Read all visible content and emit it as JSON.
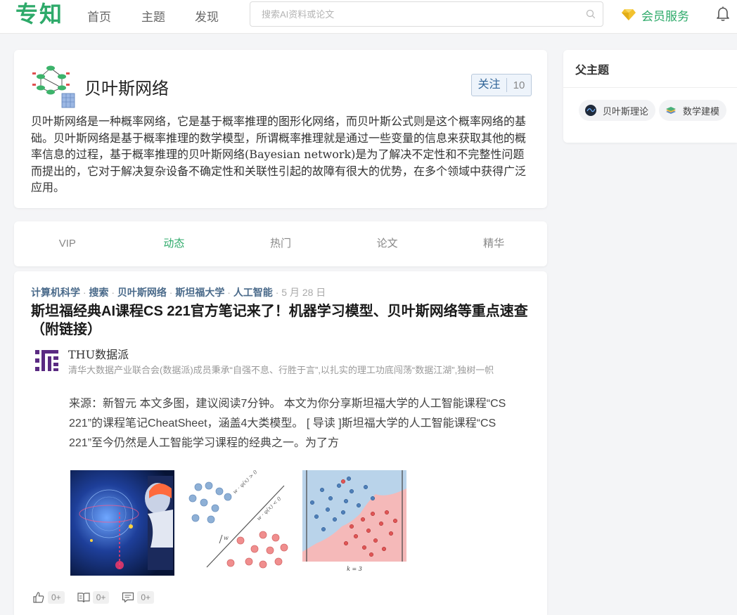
{
  "header": {
    "logo": "专知",
    "nav": [
      "首页",
      "主题",
      "发现"
    ],
    "search_placeholder": "搜索AI资料或论文",
    "vip_label": "会员服务"
  },
  "topic": {
    "title": "贝叶斯网络",
    "follow_label": "关注",
    "follow_count": "10",
    "description": "贝叶斯网络是一种概率网络，它是基于概率推理的图形化网络，而贝叶斯公式则是这个概率网络的基础。贝叶斯网络是基于概率推理的数学模型，所谓概率推理就是通过一些变量的信息来获取其他的概率信息的过程，基于概率推理的贝叶斯网络(Bayesian network)是为了解决不定性和不完整性问题而提出的，它对于解决复杂设备不确定性和关联性引起的故障有很大的优势，在多个领域中获得广泛应用。"
  },
  "tabs": [
    {
      "label": "VIP",
      "active": false
    },
    {
      "label": "动态",
      "active": true
    },
    {
      "label": "热门",
      "active": false
    },
    {
      "label": "论文",
      "active": false
    },
    {
      "label": "精华",
      "active": false
    }
  ],
  "article": {
    "tags": [
      "计算机科学",
      "搜索",
      "贝叶斯网络",
      "斯坦福大学",
      "人工智能"
    ],
    "separator": " · ",
    "date": "5 月 28 日",
    "title": "斯坦福经典AI课程CS 221官方笔记来了！机器学习模型、贝叶斯网络等重点速查（附链接）",
    "author_name": "THU数据派",
    "author_desc": "清华大数据产业联合会(数据派)成员秉承“自强不息、行胜于言”,以扎实的理工功底闯荡“数据江湖”,独树一帜",
    "excerpt": "来源：新智元 本文多图，建议阅读7分钟。 本文为你分享斯坦福大学的人工智能课程“CS 221”的课程笔记CheatSheet，涵盖4大类模型。 [ 导读 ]斯坦福大学的人工智能课程“CS 221”至今仍然是人工智能学习课程的经典之一。为了方",
    "thumb2_labels": [
      "w · φ(x) > 0",
      "w · φ(x) < 0",
      "w"
    ],
    "thumb3_caption": "k = 3",
    "counts": {
      "like": "0+",
      "read": "0+",
      "comment": "0+"
    }
  },
  "sidebar": {
    "title": "父主题",
    "chips": [
      "贝叶斯理论",
      "数学建模"
    ]
  },
  "colors": {
    "brand_green": "#2eaa6a",
    "vip_gold": "#f2c12e",
    "tag_blue": "#4a6a8a",
    "follow_blue": "#336699"
  }
}
